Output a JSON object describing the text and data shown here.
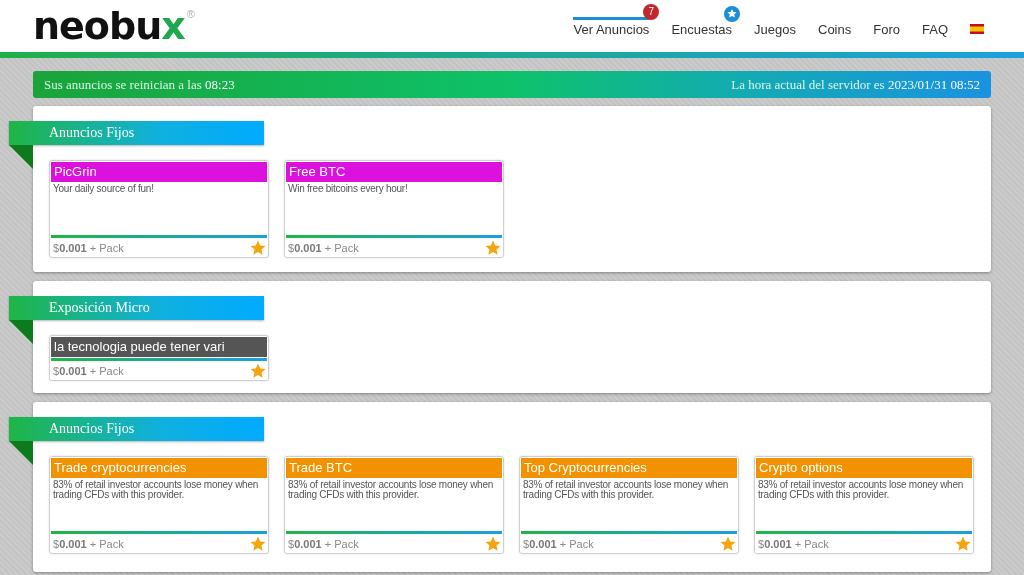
{
  "logo": {
    "text": "neobux",
    "mark": "®"
  },
  "nav": [
    {
      "label": "Ver Anuncios",
      "selected": true,
      "badge": "7",
      "kind": "count"
    },
    {
      "label": "Encuestas",
      "selected": false,
      "kind": "star"
    },
    {
      "label": "Juegos",
      "selected": false
    },
    {
      "label": "Coins",
      "selected": false
    },
    {
      "label": "Foro",
      "selected": false
    },
    {
      "label": "FAQ",
      "selected": false
    },
    {
      "kind": "flag",
      "selected": false
    }
  ],
  "banner": {
    "left": "Sus anuncios se reinician a las **08:23**",
    "right": "La hora actual del servidor es **2023/01/31 08:52**"
  },
  "sections": [
    {
      "title": "Anuncios Fijos",
      "ads": [
        {
          "title": "PicGrin",
          "description": "Your daily source of fun!",
          "color": "#dd11dd",
          "price": "$**0.001** + Pack"
        },
        {
          "title": "Free BTC",
          "description": "Win free bitcoins every hour!",
          "color": "#dd11dd",
          "price": "$**0.001** + Pack"
        }
      ]
    },
    {
      "title": "Exposición Micro",
      "ads": [
        {
          "title": "la tecnologia puede tener vari",
          "color": "#555555",
          "price": "$**0.001** + Pack"
        }
      ]
    },
    {
      "title": "Anuncios Fijos",
      "ads": [
        {
          "title": "Trade cryptocurrencies",
          "description": "83% of retail investor accounts lose money when trading CFDs with this provider.",
          "color": "#f39200",
          "price": "$**0.001** + Pack"
        },
        {
          "title": "Trade BTC",
          "description": "83% of retail investor accounts lose money when trading CFDs with this provider.",
          "color": "#f39200",
          "price": "$**0.001** + Pack"
        },
        {
          "title": "Top Cryptocurrencies",
          "description": "83% of retail investor accounts lose money when trading CFDs with this provider.",
          "color": "#f39200",
          "price": "$**0.001** + Pack"
        },
        {
          "title": "Crypto options",
          "description": "83% of retail investor accounts lose money when trading CFDs with this provider.",
          "color": "#f39200",
          "price": "$**0.001** + Pack"
        }
      ]
    }
  ]
}
